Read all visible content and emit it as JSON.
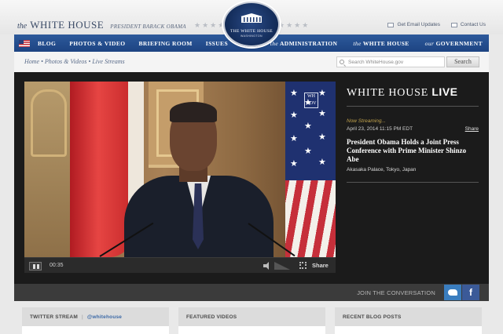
{
  "header": {
    "brand_the": "the",
    "brand_name": "WHITE HOUSE",
    "brand_president": "PRESIDENT BARACK OBAMA",
    "seal_line1": "THE WHITE HOUSE",
    "seal_line2": "WASHINGTON",
    "links": {
      "email": "Get Email Updates",
      "contact": "Contact Us"
    }
  },
  "nav": {
    "left": [
      "BLOG",
      "PHOTOS & VIDEO",
      "BRIEFING ROOM",
      "ISSUES"
    ],
    "right": [
      {
        "prefix": "the",
        "label": "ADMINISTRATION"
      },
      {
        "prefix": "the",
        "label": "WHITE HOUSE"
      },
      {
        "prefix": "our",
        "label": "GOVERNMENT"
      }
    ]
  },
  "breadcrumb": "Home • Photos & Videos • Live Streams",
  "search": {
    "placeholder": "Search WhiteHouse.gov",
    "button": "Search"
  },
  "player": {
    "bug": "WH GOV",
    "time": "00:35",
    "share": "Share"
  },
  "live": {
    "title_light": "WHITE HOUSE",
    "title_bold": "LIVE",
    "now_streaming": "Now Streaming...",
    "datetime": "April 23, 2014 11:15 PM EDT",
    "share": "Share",
    "event_title": "President Obama Holds a Joint Press Conference with Prime Minister Shinzo Abe",
    "location": "Akasaka Palace, Tokyo, Japan"
  },
  "join": {
    "label": "JOIN THE CONVERSATION",
    "facebook": "f"
  },
  "boxes": {
    "twitter": {
      "title": "TWITTER STREAM",
      "handle": "@whitehouse"
    },
    "videos": {
      "title": "FEATURED VIDEOS"
    },
    "blog": {
      "title": "RECENT BLOG POSTS"
    }
  },
  "colors": {
    "nav": "#1d4482",
    "accent_gold": "#c1a24c",
    "twitter": "#3a7dbf",
    "facebook": "#3b5a98"
  }
}
